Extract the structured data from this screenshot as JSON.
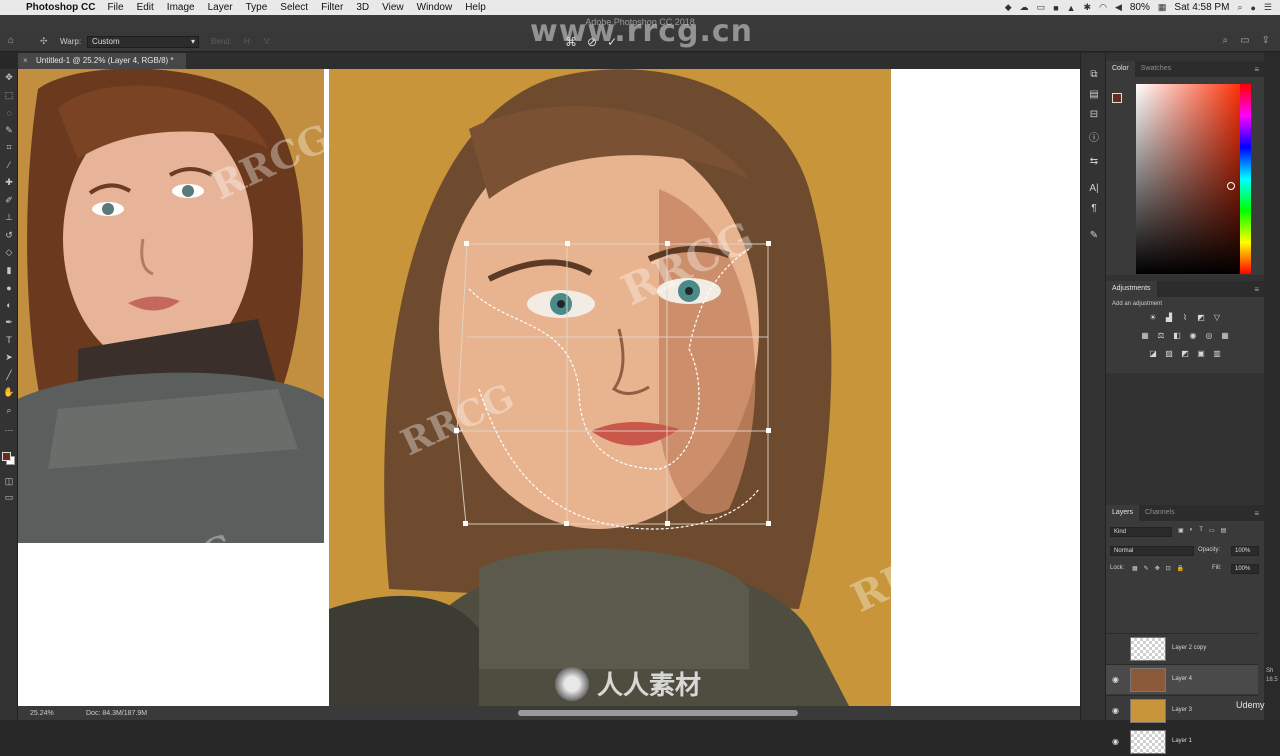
{
  "menubar": {
    "app_name": "Photoshop CC",
    "items": [
      "File",
      "Edit",
      "Image",
      "Layer",
      "Type",
      "Select",
      "Filter",
      "3D",
      "View",
      "Window",
      "Help"
    ],
    "battery": "80%",
    "clock": "Sat 4:58 PM"
  },
  "window": {
    "title": "Adobe Photoshop CC 2018"
  },
  "options": {
    "warp_label": "Warp:",
    "warp_value": "Custom",
    "dim1": "Bend:",
    "dim2": "H:",
    "dim3": "V:"
  },
  "document": {
    "tab_title": "Untitled-1 @ 25.2% (Layer 4, RGB/8) *"
  },
  "status": {
    "zoom": "25.24%",
    "doc": "Doc: 84.3M/187.9M"
  },
  "color_panel": {
    "tabs": [
      "Color",
      "Swatches"
    ],
    "foreground": "#6e2a20"
  },
  "adjustments_panel": {
    "title": "Adjustments",
    "hint": "Add an adjustment"
  },
  "layers_panel": {
    "tabs": [
      "Layers",
      "Channels"
    ],
    "search_placeholder": "Kind",
    "blend_mode": "Normal",
    "opacity_label": "Opacity:",
    "opacity_value": "100%",
    "lock_label": "Lock:",
    "fill_label": "Fill:",
    "fill_value": "100%",
    "layers": [
      {
        "name": "Layer 2 copy",
        "visible": false,
        "selected": false
      },
      {
        "name": "Layer 4",
        "visible": true,
        "selected": true
      },
      {
        "name": "Layer 3",
        "visible": true,
        "selected": false
      },
      {
        "name": "Layer 1",
        "visible": true,
        "selected": false
      }
    ]
  },
  "watermarks": {
    "top": "www.rrcg.cn",
    "bottom": "人人素材",
    "brand": "Udemy"
  },
  "edge_labels": [
    "Sh",
    "18.5"
  ]
}
